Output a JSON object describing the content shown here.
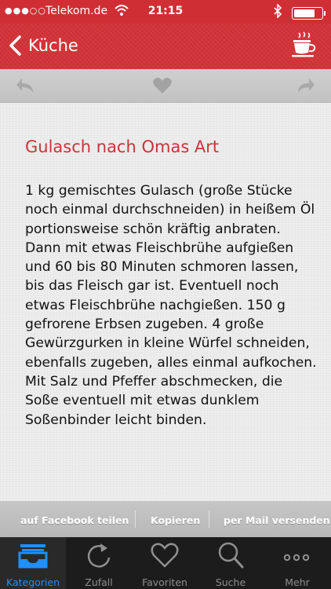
{
  "status": {
    "carrier": "Telekom.de",
    "time": "21:15",
    "battery_level": 0.8
  },
  "nav": {
    "back_label": "Küche",
    "back_icon": "chevron-left-icon",
    "right_icon": "coffee-cup-icon"
  },
  "toolbar": {
    "left_icon": "undo-arrow-icon",
    "center_icon": "heart-icon",
    "right_icon": "redo-arrow-icon"
  },
  "recipe": {
    "title": "Gulasch nach Omas Art",
    "text": "1 kg gemischtes Gulasch (große Stücke noch einmal durchschneiden) in heißem Öl portionsweise schön kräftig anbraten. Dann mit etwas Fleischbrühe aufgießen und 60 bis 80 Minuten schmoren lassen, bis das Fleisch gar ist. Eventuell noch etwas Fleischbrühe nachgießen. 150 g gefrorene Erbsen zugeben. 4 große Gewürzgurken in kleine Würfel schneiden, ebenfalls zugeben, alles einmal aufkochen. Mit Salz und Pfeffer abschmecken, die Soße eventuell mit etwas dunklem Soßenbinder leicht binden."
  },
  "actions": {
    "facebook": "auf Facebook teilen",
    "copy": "Kopieren",
    "mail": "per Mail versenden"
  },
  "tabs": [
    {
      "label": "Kategorien",
      "icon": "inbox-tray-icon",
      "active": true
    },
    {
      "label": "Zufall",
      "icon": "refresh-icon",
      "active": false
    },
    {
      "label": "Favoriten",
      "icon": "heart-outline-icon",
      "active": false
    },
    {
      "label": "Suche",
      "icon": "magnifier-icon",
      "active": false
    },
    {
      "label": "Mehr",
      "icon": "more-dots-icon",
      "active": false
    }
  ],
  "colors": {
    "brand_red": "#d23338",
    "title_red": "#c8343a",
    "tab_active": "#1e90ff"
  }
}
